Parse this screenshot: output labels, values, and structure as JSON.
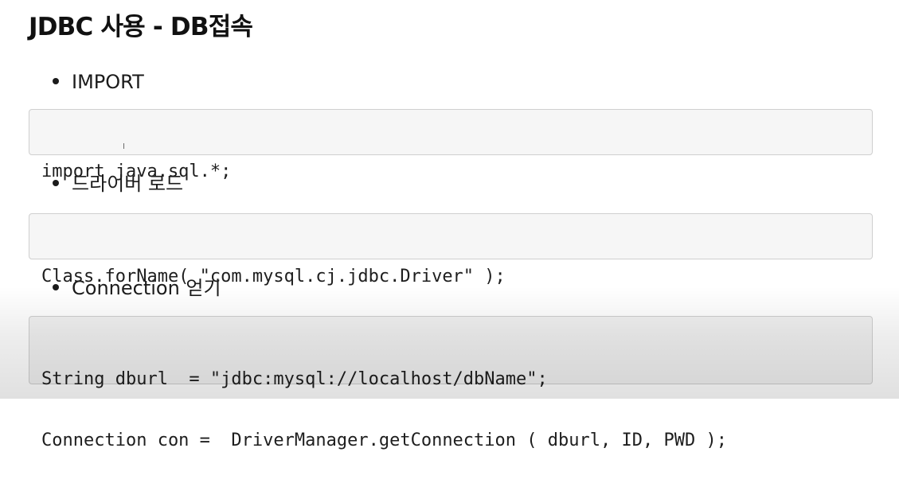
{
  "title": "JDBC 사용 - DB접속",
  "sections": [
    {
      "bullet": "IMPORT",
      "code": [
        "import java.sql.*;"
      ]
    },
    {
      "bullet": "드라이버 로드",
      "code": [
        "Class.forName( \"com.mysql.cj.jdbc.Driver\" );"
      ]
    },
    {
      "bullet": "Connection 얻기",
      "code": [
        "String dburl  = \"jdbc:mysql://localhost/dbName\";",
        "Connection con =  DriverManager.getConnection ( dburl, ID, PWD );"
      ]
    }
  ],
  "cursor_glyph": "I"
}
